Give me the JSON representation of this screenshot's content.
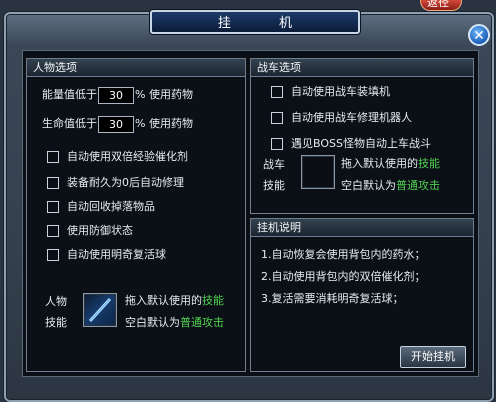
{
  "top_badge": "返径",
  "title": "挂  机",
  "close_label": "✕",
  "character": {
    "header": "人物选项",
    "hp_row": {
      "prefix": "能量值低于",
      "value": "30",
      "suffix": "% 使用药物"
    },
    "mp_row": {
      "prefix": "生命值低于",
      "value": "30",
      "suffix": "% 使用药物"
    },
    "options": [
      "自动使用双倍经验催化剂",
      "装备耐久为0后自动修理",
      "自动回收掉落物品",
      "使用防御状态",
      "自动使用明奇复活球"
    ],
    "skill_label_1": "人物",
    "skill_label_2": "技能",
    "hint1_prefix": "拖入默认使用的",
    "hint1_hl": "技能",
    "hint2_prefix": "空白默认为",
    "hint2_hl": "普通攻击"
  },
  "vehicle": {
    "header": "战车选项",
    "options": [
      "自动使用战车装填机",
      "自动使用战车修理机器人",
      "遇见BOSS怪物自动上车战斗"
    ],
    "skill_label_1": "战车",
    "skill_label_2": "技能",
    "hint1_prefix": "拖入默认使用的",
    "hint1_hl": "技能",
    "hint2_prefix": "空白默认为",
    "hint2_hl": "普通攻击"
  },
  "notes": {
    "header": "挂机说明",
    "items": [
      "1.自动恢复会使用背包内的药水；",
      "2.自动使用背包内的双倍催化剂；",
      "3.复活需要消耗明奇复活球；"
    ]
  },
  "start_button": "开始挂机",
  "colors": {
    "highlight": "#4fd24f",
    "title_bg": "#0b1c3a"
  }
}
